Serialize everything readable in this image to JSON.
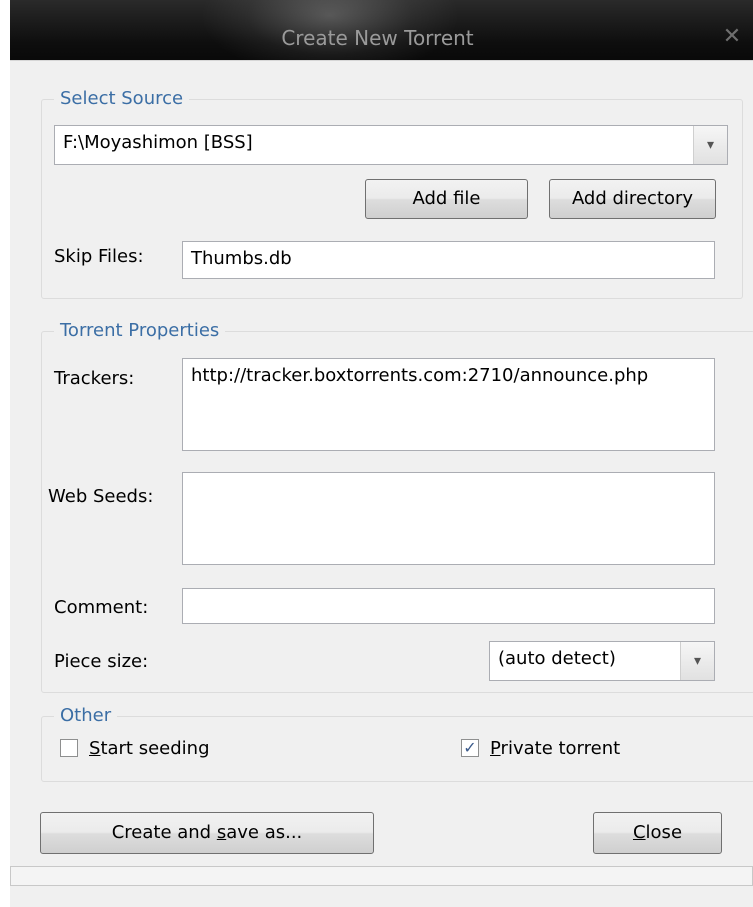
{
  "window": {
    "title": "Create New Torrent",
    "close_glyph": "✕",
    "close_icon": "close-icon"
  },
  "select_source": {
    "legend": "Select Source",
    "source_value": "F:\\Moyashimon [BSS]",
    "add_file": "Add file",
    "add_directory": "Add directory",
    "skip_files_label": "Skip Files:",
    "skip_files_value": "Thumbs.db"
  },
  "torrent_properties": {
    "legend": "Torrent Properties",
    "trackers_label": "Trackers:",
    "trackers_value": "http://tracker.boxtorrents.com:2710/announce.php",
    "web_seeds_label": "Web Seeds:",
    "web_seeds_value": "",
    "comment_label": "Comment:",
    "comment_value": "",
    "piece_size_label": "Piece size:",
    "piece_size_value": "(auto detect)"
  },
  "other": {
    "legend": "Other",
    "start_seeding": {
      "prefix": "",
      "accel": "S",
      "rest": "tart seeding",
      "checked": false
    },
    "private_torrent": {
      "prefix": "",
      "accel": "P",
      "rest": "rivate torrent",
      "checked": true
    }
  },
  "actions": {
    "create_save": {
      "prefix": "Create and ",
      "accel": "s",
      "rest": "ave as..."
    },
    "close": {
      "prefix": "",
      "accel": "C",
      "rest": "lose"
    }
  },
  "icons": {
    "dropdown_arrow": "▾",
    "check_mark": "✓"
  }
}
